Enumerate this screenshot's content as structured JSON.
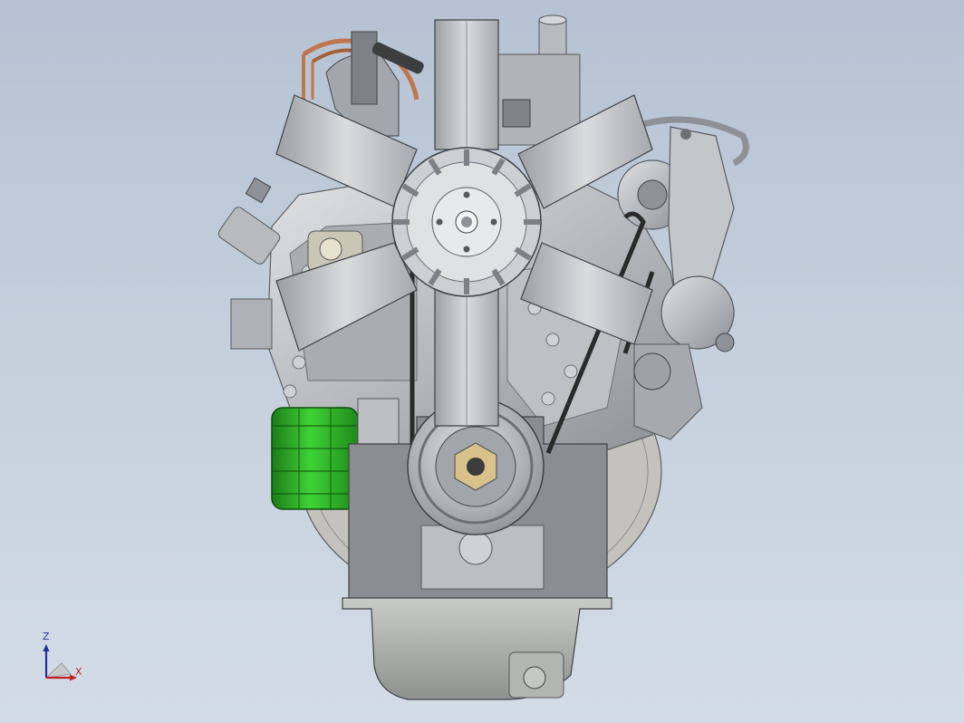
{
  "viewport": {
    "background_top": "#b5c2d3",
    "background_bottom": "#d3dce6"
  },
  "model": {
    "subject": "engine-front-view",
    "colors": {
      "steel": "#b4b8bd",
      "steel_dark": "#7d8186",
      "steel_light": "#d8dadd",
      "fan": "#c7c9cb",
      "oil_filter": "#2fb52a",
      "oil_filter_dark": "#1b7d17",
      "copper_line": "#c0764c",
      "belt": "#2a2a2a",
      "block_bracket": "#8b8d90"
    }
  },
  "triad": {
    "z_label": "Z",
    "x_label": "X",
    "z_color": "#1f2fa8",
    "x_color": "#c42020"
  }
}
